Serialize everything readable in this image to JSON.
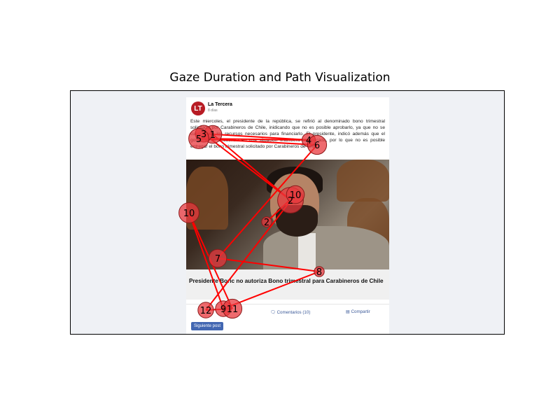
{
  "figure": {
    "title": "Gaze Duration and Path Visualization"
  },
  "post": {
    "page_name": "La Tercera",
    "avatar_text": "LT",
    "time": "8 días",
    "body": "Este miercoles, el presidente de la república, se refirió al denominado bono trimestral solicitado por Carabineros de Chile, inidicando que no es posible aprobarlo, ya que no se cuenta con los recursos necesarios para financiarlo. El presidente, indicó además que el gobierno se encuentra en una situación financiera complicada, por lo que no es posible entregar el bono trimestral solicitado por Carabineros de Chile.",
    "headline": "Presidente Boric no autoriza Bono trimestral para Carabineros de Chile",
    "comments_label": "Comentarios (10)",
    "share_label": "Compartir",
    "next_button": "Siguiente post"
  },
  "gaze": {
    "color": "#ff0000",
    "fill": "#e8383d",
    "fixations": [
      {
        "id": "1",
        "duration": 0.55
      },
      {
        "id": "2",
        "duration": 0.9
      },
      {
        "id": "3",
        "duration": 0.5
      },
      {
        "id": "4",
        "duration": 0.35
      },
      {
        "id": "5",
        "duration": 0.65
      },
      {
        "id": "6",
        "duration": 0.6
      },
      {
        "id": "7",
        "duration": 0.55
      },
      {
        "id": "8",
        "duration": 0.2
      },
      {
        "id": "9",
        "duration": 0.45
      },
      {
        "id": "10",
        "duration": 0.65
      },
      {
        "id": "11",
        "duration": 0.6
      },
      {
        "id": "12",
        "duration": 0.45
      },
      {
        "id": "10",
        "duration": 0.55
      },
      {
        "id": "2",
        "duration": 0.2
      }
    ]
  }
}
